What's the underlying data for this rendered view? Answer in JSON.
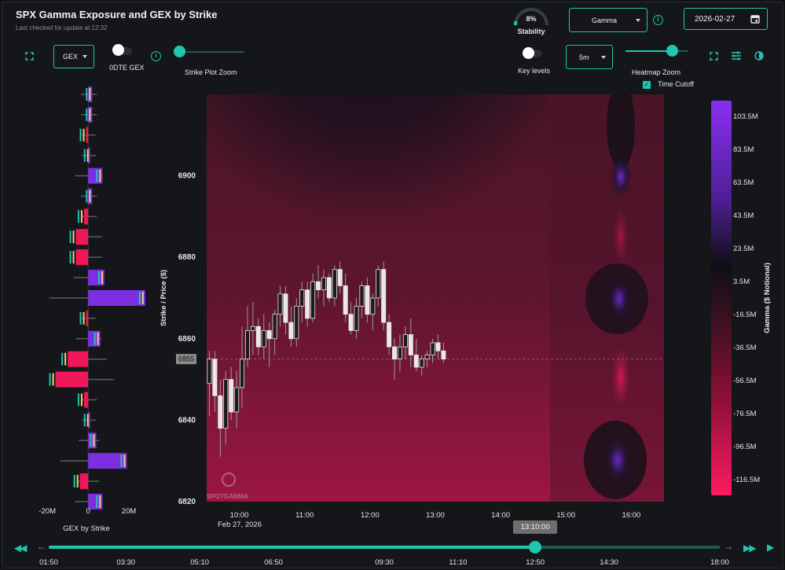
{
  "header": {
    "title": "SPX Gamma Exposure and GEX by Strike",
    "subtitle": "Last checked for update at 12:32",
    "stability_value": "8%",
    "stability_fraction": 0.08,
    "stability_label": "Stability",
    "metric_select": "Gamma",
    "date": "2026-02-27"
  },
  "toolbar": {
    "gex_select": "GEX",
    "odte_label": "0DTE GEX",
    "strike_zoom_label": "Strike Plot Zoom",
    "key_levels_label": "Key levels",
    "interval_select": "5m",
    "heatmap_zoom_label": "Heatmap Zoom",
    "time_cutoff_label": "Time Cutoff",
    "time_cutoff_checked": true
  },
  "colors": {
    "accent": "#1fc7b0",
    "positive": "#7b2fe0",
    "negative": "#f0175a",
    "candle": "#e8e8e8"
  },
  "chart_data": [
    {
      "type": "bar",
      "orientation": "horizontal",
      "title": "GEX by Strike",
      "xlabel": "GEX by Strike",
      "x_ticks": [
        "-20M",
        "0",
        "20M"
      ],
      "xlim": [
        -22000000,
        30000000
      ],
      "strikes": [
        6920,
        6915,
        6910,
        6905,
        6900,
        6895,
        6890,
        6885,
        6880,
        6875,
        6870,
        6865,
        6860,
        6855,
        6850,
        6845,
        6840,
        6835,
        6830,
        6825,
        6820
      ],
      "values": [
        2000000,
        2000000,
        -1000000,
        1000000,
        7000000,
        2000000,
        -2000000,
        -6000000,
        -6000000,
        8000000,
        28000000,
        -1000000,
        6000000,
        -10000000,
        -16000000,
        -2000000,
        1000000,
        4000000,
        19000000,
        -4000000,
        7000000
      ]
    },
    {
      "type": "heatmap",
      "ylabel": "Strike / Price ($)",
      "y_ticks": [
        "6820",
        "6840",
        "6860",
        "6880",
        "6900"
      ],
      "ylim": [
        6820,
        6920
      ],
      "x_ticks": [
        "10:00",
        "11:00",
        "12:00",
        "13:00",
        "14:00",
        "15:00",
        "16:00"
      ],
      "x_date_label": "Feb 27, 2026",
      "xlim": [
        "09:30",
        "16:30"
      ],
      "current_price_label": "6855",
      "current_price": 6855,
      "colorbar_label": "Gamma ($ Notional)",
      "colorbar_ticks": [
        "103.5M",
        "83.5M",
        "63.5M",
        "43.5M",
        "23.5M",
        "3.5M",
        "-16.5M",
        "-36.5M",
        "-56.5M",
        "-76.5M",
        "-96.5M",
        "-116.5M"
      ],
      "colorbar_range": [
        -126500000,
        113500000
      ],
      "watermark": "SPOTGAMMA",
      "candles_interval": "5m",
      "candles": [
        {
          "t": "09:30",
          "o": 6849,
          "h": 6857,
          "l": 6841,
          "c": 6855
        },
        {
          "t": "09:35",
          "o": 6855,
          "h": 6857,
          "l": 6842,
          "c": 6846
        },
        {
          "t": "09:40",
          "o": 6846,
          "h": 6850,
          "l": 6831,
          "c": 6838
        },
        {
          "t": "09:45",
          "o": 6838,
          "h": 6852,
          "l": 6834,
          "c": 6850
        },
        {
          "t": "09:50",
          "o": 6850,
          "h": 6853,
          "l": 6840,
          "c": 6842
        },
        {
          "t": "09:55",
          "o": 6842,
          "h": 6852,
          "l": 6838,
          "c": 6848
        },
        {
          "t": "10:00",
          "o": 6848,
          "h": 6863,
          "l": 6843,
          "c": 6855
        },
        {
          "t": "10:05",
          "o": 6855,
          "h": 6868,
          "l": 6853,
          "c": 6862
        },
        {
          "t": "10:10",
          "o": 6862,
          "h": 6869,
          "l": 6856,
          "c": 6863
        },
        {
          "t": "10:15",
          "o": 6863,
          "h": 6865,
          "l": 6856,
          "c": 6858
        },
        {
          "t": "10:20",
          "o": 6858,
          "h": 6866,
          "l": 6855,
          "c": 6862
        },
        {
          "t": "10:25",
          "o": 6862,
          "h": 6864,
          "l": 6853,
          "c": 6860
        },
        {
          "t": "10:30",
          "o": 6860,
          "h": 6867,
          "l": 6856,
          "c": 6866
        },
        {
          "t": "10:35",
          "o": 6866,
          "h": 6873,
          "l": 6863,
          "c": 6871
        },
        {
          "t": "10:40",
          "o": 6871,
          "h": 6873,
          "l": 6861,
          "c": 6864
        },
        {
          "t": "10:45",
          "o": 6864,
          "h": 6868,
          "l": 6858,
          "c": 6860
        },
        {
          "t": "10:50",
          "o": 6860,
          "h": 6870,
          "l": 6858,
          "c": 6868
        },
        {
          "t": "10:55",
          "o": 6868,
          "h": 6874,
          "l": 6864,
          "c": 6872
        },
        {
          "t": "11:00",
          "o": 6872,
          "h": 6874,
          "l": 6863,
          "c": 6865
        },
        {
          "t": "11:05",
          "o": 6865,
          "h": 6876,
          "l": 6864,
          "c": 6874
        },
        {
          "t": "11:10",
          "o": 6874,
          "h": 6878,
          "l": 6870,
          "c": 6872
        },
        {
          "t": "11:15",
          "o": 6872,
          "h": 6877,
          "l": 6868,
          "c": 6875
        },
        {
          "t": "11:20",
          "o": 6875,
          "h": 6876,
          "l": 6869,
          "c": 6870
        },
        {
          "t": "11:25",
          "o": 6870,
          "h": 6878,
          "l": 6868,
          "c": 6877
        },
        {
          "t": "11:30",
          "o": 6877,
          "h": 6879,
          "l": 6871,
          "c": 6873
        },
        {
          "t": "11:35",
          "o": 6873,
          "h": 6876,
          "l": 6864,
          "c": 6866
        },
        {
          "t": "11:40",
          "o": 6866,
          "h": 6869,
          "l": 6861,
          "c": 6862
        },
        {
          "t": "11:45",
          "o": 6862,
          "h": 6870,
          "l": 6860,
          "c": 6868
        },
        {
          "t": "11:50",
          "o": 6868,
          "h": 6874,
          "l": 6865,
          "c": 6873
        },
        {
          "t": "11:55",
          "o": 6873,
          "h": 6875,
          "l": 6864,
          "c": 6866
        },
        {
          "t": "12:00",
          "o": 6866,
          "h": 6871,
          "l": 6862,
          "c": 6870
        },
        {
          "t": "12:05",
          "o": 6870,
          "h": 6878,
          "l": 6868,
          "c": 6877
        },
        {
          "t": "12:10",
          "o": 6877,
          "h": 6879,
          "l": 6862,
          "c": 6864
        },
        {
          "t": "12:15",
          "o": 6864,
          "h": 6866,
          "l": 6856,
          "c": 6858
        },
        {
          "t": "12:20",
          "o": 6858,
          "h": 6860,
          "l": 6850,
          "c": 6855
        },
        {
          "t": "12:25",
          "o": 6855,
          "h": 6861,
          "l": 6852,
          "c": 6858
        },
        {
          "t": "12:30",
          "o": 6858,
          "h": 6863,
          "l": 6855,
          "c": 6861
        },
        {
          "t": "12:35",
          "o": 6861,
          "h": 6865,
          "l": 6853,
          "c": 6856
        },
        {
          "t": "12:40",
          "o": 6856,
          "h": 6860,
          "l": 6852,
          "c": 6853
        },
        {
          "t": "12:45",
          "o": 6853,
          "h": 6856,
          "l": 6851,
          "c": 6855
        },
        {
          "t": "12:50",
          "o": 6855,
          "h": 6857,
          "l": 6853,
          "c": 6856
        },
        {
          "t": "12:55",
          "o": 6856,
          "h": 6860,
          "l": 6854,
          "c": 6859
        },
        {
          "t": "13:00",
          "o": 6859,
          "h": 6861,
          "l": 6855,
          "c": 6857
        },
        {
          "t": "13:05",
          "o": 6857,
          "h": 6859,
          "l": 6854,
          "c": 6855
        }
      ]
    }
  ],
  "timeline": {
    "tooltip": "13:10:00",
    "slider_fraction": 0.725,
    "ticks": [
      "01:50",
      "03:30",
      "05:10",
      "06:50",
      "09:30",
      "11:10",
      "12:50",
      "14:30",
      "18:00"
    ],
    "tick_fractions": [
      0.0,
      0.115,
      0.225,
      0.335,
      0.5,
      0.61,
      0.725,
      0.835,
      1.0
    ]
  }
}
